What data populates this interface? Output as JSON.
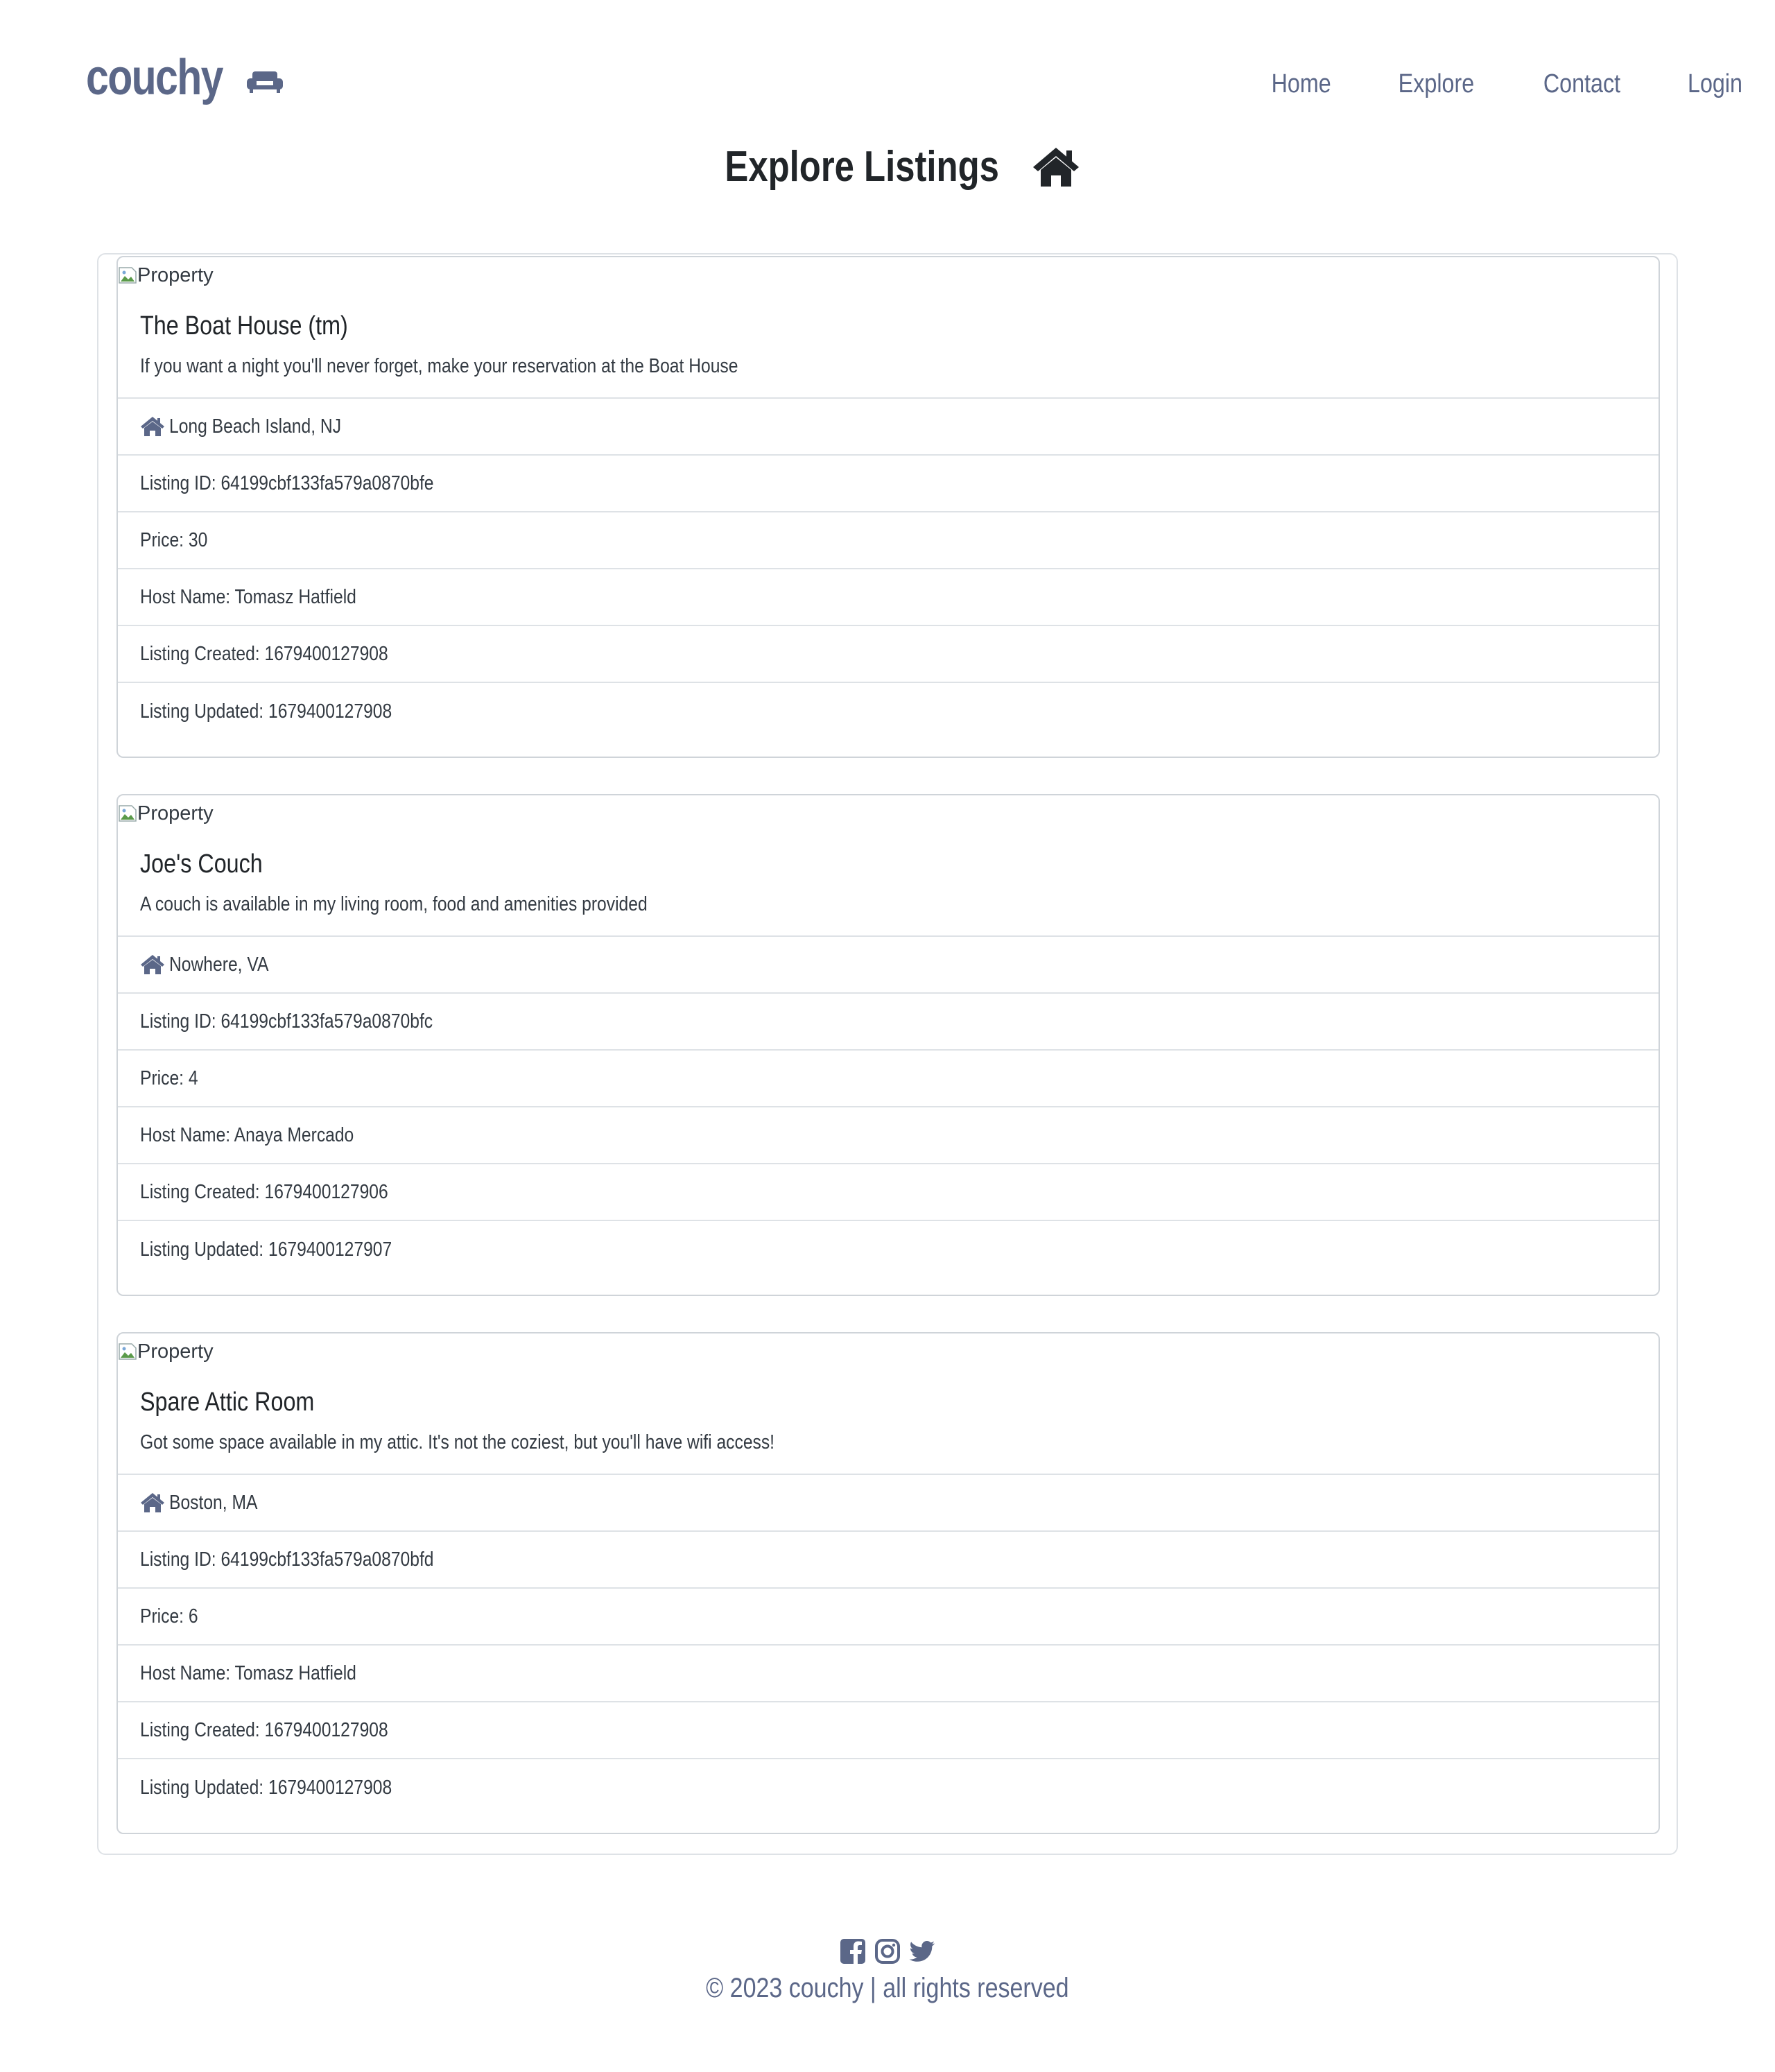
{
  "brand": {
    "name": "couchy"
  },
  "nav": {
    "items": [
      {
        "label": "Home"
      },
      {
        "label": "Explore"
      },
      {
        "label": "Contact"
      },
      {
        "label": "Login"
      }
    ]
  },
  "page": {
    "title": "Explore Listings"
  },
  "listings": [
    {
      "image_alt": "Property",
      "title": "The Boat House (tm)",
      "description": "If you want a night you'll never forget, make your reservation at the Boat House",
      "location": "Long Beach Island, NJ",
      "listing_id": "Listing ID: 64199cbf133fa579a0870bfe",
      "price": "Price: 30",
      "host": "Host Name: Tomasz Hatfield",
      "created": "Listing Created: 1679400127908",
      "updated": "Listing Updated: 1679400127908"
    },
    {
      "image_alt": "Property",
      "title": "Joe's Couch",
      "description": "A couch is available in my living room, food and amenities provided",
      "location": "Nowhere, VA",
      "listing_id": "Listing ID: 64199cbf133fa579a0870bfc",
      "price": "Price: 4",
      "host": "Host Name: Anaya Mercado",
      "created": "Listing Created: 1679400127906",
      "updated": "Listing Updated: 1679400127907"
    },
    {
      "image_alt": "Property",
      "title": "Spare Attic Room",
      "description": "Got some space available in my attic. It's not the coziest, but you'll have wifi access!",
      "location": "Boston, MA",
      "listing_id": "Listing ID: 64199cbf133fa579a0870bfd",
      "price": "Price: 6",
      "host": "Host Name: Tomasz Hatfield",
      "created": "Listing Created: 1679400127908",
      "updated": "Listing Updated: 1679400127908"
    }
  ],
  "footer": {
    "icons": [
      "facebook-icon",
      "instagram-icon",
      "twitter-icon"
    ],
    "copyright": "© 2023 couchy | all rights reserved"
  },
  "colors": {
    "brand": "#5b6788",
    "text": "#333a42",
    "heading": "#212529",
    "border": "#dee2e6"
  }
}
